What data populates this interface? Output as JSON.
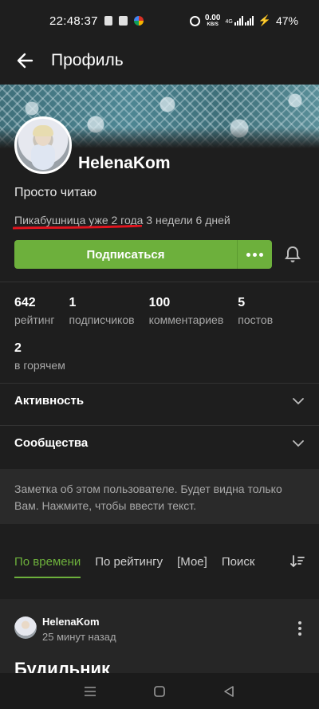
{
  "status_bar": {
    "time": "22:48:37",
    "net_speed_value": "0.00",
    "net_speed_unit": "KB/S",
    "network_type": "4G",
    "battery": "47%"
  },
  "app_bar": {
    "title": "Профиль"
  },
  "profile": {
    "username": "HelenaKom",
    "bio": "Просто читаю",
    "tenure": "Пикабушница уже 2 года 3 недели 6 дней",
    "subscribe_label": "Подписаться"
  },
  "stats": [
    {
      "value": "642",
      "label": "рейтинг"
    },
    {
      "value": "1",
      "label": "подписчиков"
    },
    {
      "value": "100",
      "label": "комментариев"
    },
    {
      "value": "5",
      "label": "постов"
    },
    {
      "value": "2",
      "label": "в горячем"
    }
  ],
  "sections": {
    "activity": "Активность",
    "communities": "Сообщества"
  },
  "note": {
    "placeholder": "Заметка об этом пользователе. Будет видна только Вам. Нажмите, чтобы ввести текст."
  },
  "tabs": [
    {
      "label": "По времени",
      "active": true
    },
    {
      "label": "По рейтингу",
      "active": false
    },
    {
      "label": "[Мое]",
      "active": false
    },
    {
      "label": "Поиск",
      "active": false
    }
  ],
  "post": {
    "author": "HelenaKom",
    "time": "25 минут назад",
    "title": "Будильник"
  },
  "colors": {
    "accent": "#6db03c",
    "background": "#1e1e1e",
    "annotation_line": "#e0141e"
  }
}
